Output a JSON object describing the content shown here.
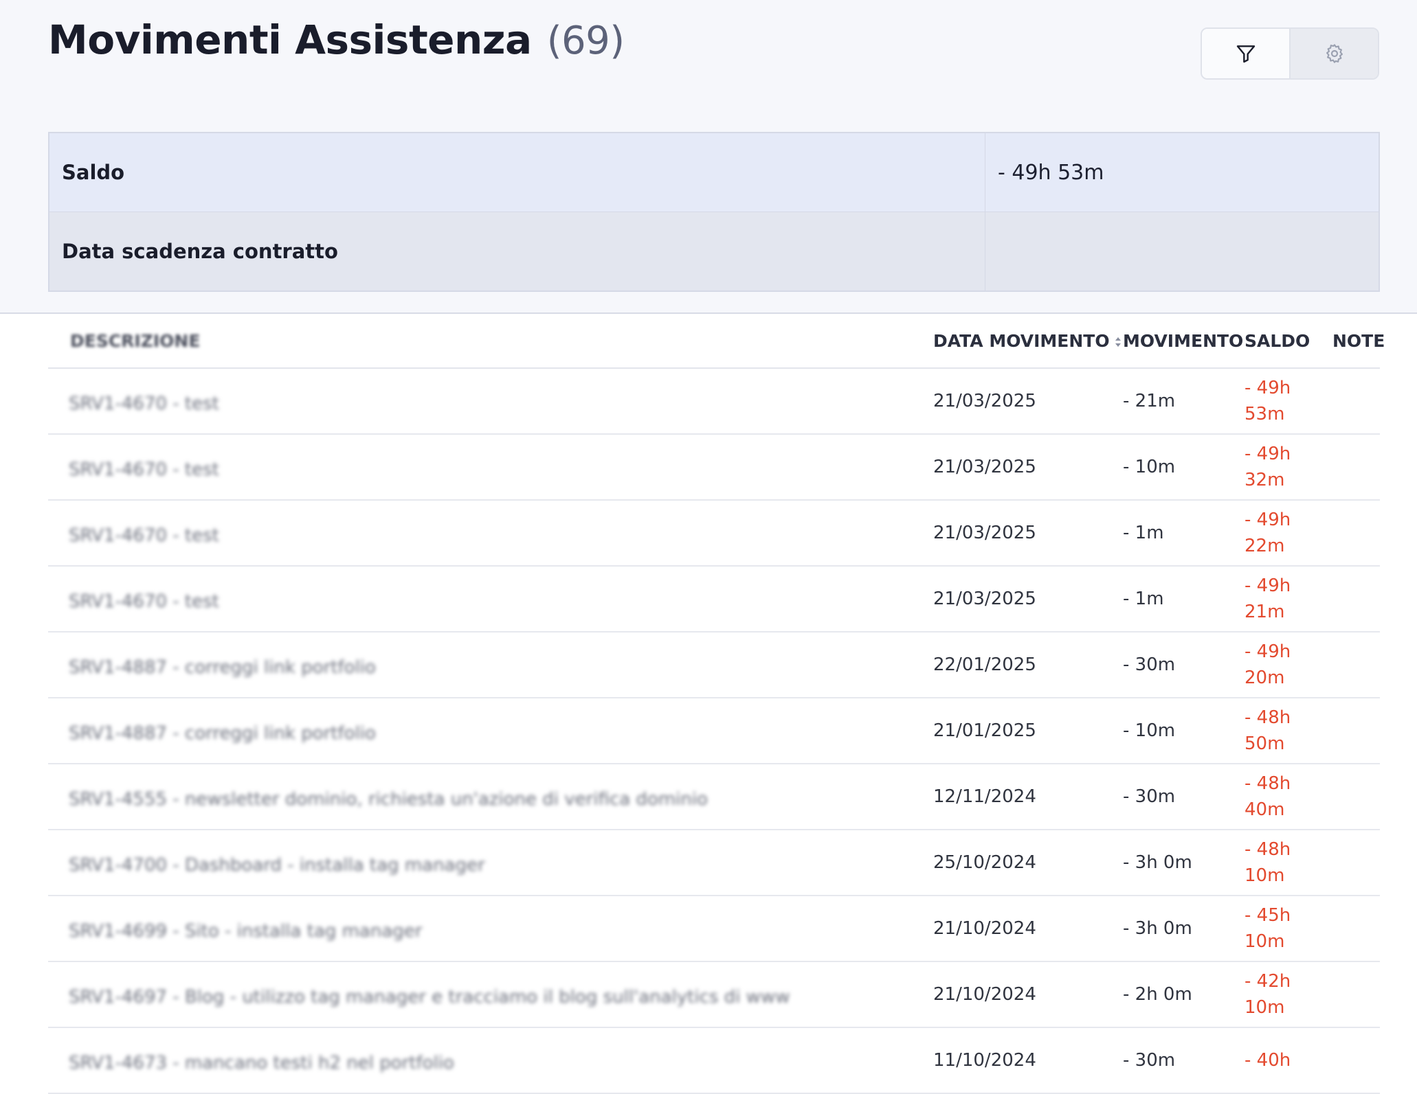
{
  "header": {
    "title": "Movimenti Assistenza",
    "count": "(69)",
    "filter_icon": "filter-icon",
    "settings_icon": "gear-icon"
  },
  "summary": {
    "rows": [
      {
        "label": "Saldo",
        "value": "- 49h 53m"
      },
      {
        "label": "Data scadenza contratto",
        "value": ""
      }
    ]
  },
  "table": {
    "columns": {
      "description": "DESCRIZIONE",
      "date": "DATA MOVIMENTO",
      "movement": "MOVIMENTO",
      "balance": "SALDO",
      "notes": "NOTE"
    },
    "rows": [
      {
        "description": "SRV1-4670 - test",
        "date": "21/03/2025",
        "movement": "- 21m",
        "balance_h": "- 49h",
        "balance_m": "53m"
      },
      {
        "description": "SRV1-4670 - test",
        "date": "21/03/2025",
        "movement": "- 10m",
        "balance_h": "- 49h",
        "balance_m": "32m"
      },
      {
        "description": "SRV1-4670 - test",
        "date": "21/03/2025",
        "movement": "- 1m",
        "balance_h": "- 49h",
        "balance_m": "22m"
      },
      {
        "description": "SRV1-4670 - test",
        "date": "21/03/2025",
        "movement": "- 1m",
        "balance_h": "- 49h",
        "balance_m": "21m"
      },
      {
        "description": "SRV1-4887 - correggi link portfolio",
        "date": "22/01/2025",
        "movement": "- 30m",
        "balance_h": "- 49h",
        "balance_m": "20m"
      },
      {
        "description": "SRV1-4887 - correggi link portfolio",
        "date": "21/01/2025",
        "movement": "- 10m",
        "balance_h": "- 48h",
        "balance_m": "50m"
      },
      {
        "description": "SRV1-4555 - newsletter dominio, richiesta un'azione di verifica dominio",
        "date": "12/11/2024",
        "movement": "- 30m",
        "balance_h": "- 48h",
        "balance_m": "40m"
      },
      {
        "description": "SRV1-4700 - Dashboard - installa tag manager",
        "date": "25/10/2024",
        "movement": "- 3h 0m",
        "balance_h": "- 48h",
        "balance_m": "10m"
      },
      {
        "description": "SRV1-4699 - Sito - installa tag manager",
        "date": "21/10/2024",
        "movement": "- 3h 0m",
        "balance_h": "- 45h",
        "balance_m": "10m"
      },
      {
        "description": "SRV1-4697 - Blog - utilizzo tag manager e tracciamo il blog sull'analytics di www",
        "date": "21/10/2024",
        "movement": "- 2h 0m",
        "balance_h": "- 42h",
        "balance_m": "10m"
      },
      {
        "description": "SRV1-4673 - mancano testi h2 nel portfolio",
        "date": "11/10/2024",
        "movement": "- 30m",
        "balance_h": "- 40h",
        "balance_m": ""
      }
    ]
  }
}
